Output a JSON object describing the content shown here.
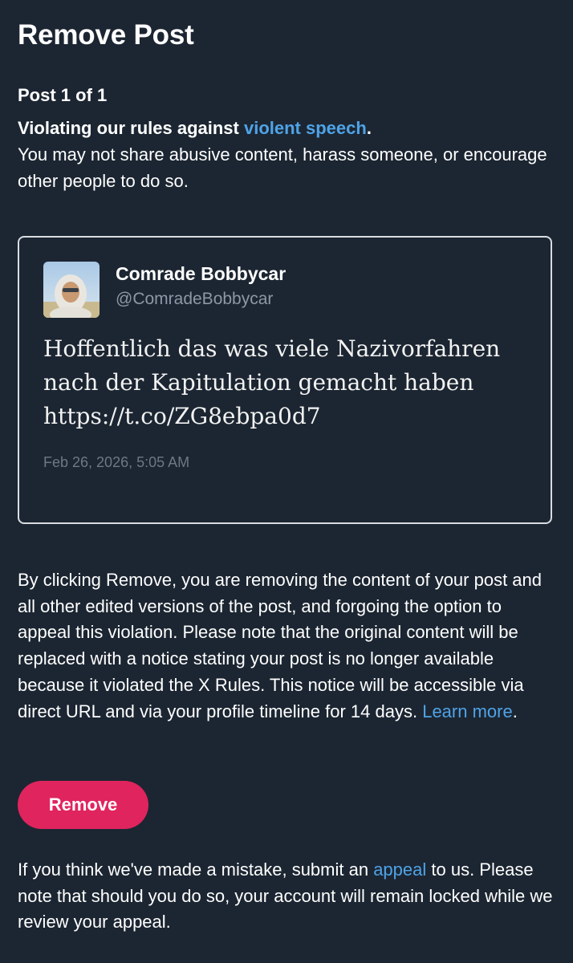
{
  "page": {
    "title": "Remove Post"
  },
  "violation": {
    "post_counter": "Post 1 of 1",
    "heading_prefix": "Violating our rules against ",
    "rule_link": "violent speech",
    "heading_suffix": ".",
    "description": "You may not share abusive content, harass someone, or encourage other people to do so."
  },
  "post": {
    "display_name": "Comrade Bobbycar",
    "handle": "@ComradeBobbycar",
    "text": "Hoffentlich das was viele Nazivorfahren nach der Kapitulation gemacht haben https://t.co/ZG8ebpa0d7",
    "timestamp": "Feb 26, 2026, 5:05 AM",
    "avatar_icon": "profile-photo"
  },
  "disclaimer": {
    "text": "By clicking Remove, you are removing the content of your post and all other edited versions of the post, and forgoing the option to appeal this violation. Please note that the original content will be replaced with a notice stating your post is no longer available because it violated the X Rules. This notice will be accessible via direct URL and via your profile timeline for 14 days. ",
    "learn_more": "Learn more",
    "end": "."
  },
  "actions": {
    "remove_label": "Remove"
  },
  "appeal": {
    "prefix": "If you think we've made a mistake, submit an ",
    "link": "appeal",
    "suffix": " to us. Please note that should you do so, your account will remain locked while we review your appeal."
  },
  "colors": {
    "background": "#1c2632",
    "link": "#4fa3e7",
    "danger": "#e0245e",
    "muted": "#8c98a5"
  }
}
